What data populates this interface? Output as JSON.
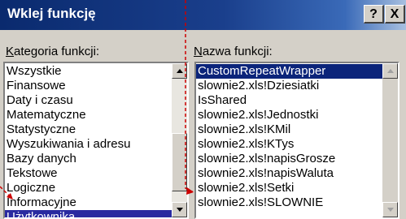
{
  "dialog": {
    "title": "Wklej funkcję",
    "help_button": "?",
    "close_button": "X"
  },
  "categories": {
    "label_accel": "K",
    "label_rest": "ategoria funkcji:",
    "items": [
      "Wszystkie",
      "Finansowe",
      "Daty i czasu",
      "Matematyczne",
      "Statystyczne",
      "Wyszukiwania i adresu",
      "Bazy danych",
      "Tekstowe",
      "Logiczne",
      "Informacyjne",
      "Użytkownika"
    ],
    "selected": "Użytkownika"
  },
  "functions": {
    "label_accel": "N",
    "label_rest": "azwa funkcji:",
    "items": [
      "CustomRepeatWrapper",
      "slownie2.xls!Dziesiatki",
      "IsShared",
      "slownie2.xls!Jednostki",
      "slownie2.xls!KMil",
      "slownie2.xls!KTys",
      "slownie2.xls!napisGrosze",
      "slownie2.xls!napisWaluta",
      "slownie2.xls!Setki",
      "slownie2.xls!SLOWNIE"
    ],
    "selected": "CustomRepeatWrapper"
  },
  "colors": {
    "titlebar": "#0a2a6e",
    "selection": "#0b247a",
    "annotation": "#cc0000"
  }
}
